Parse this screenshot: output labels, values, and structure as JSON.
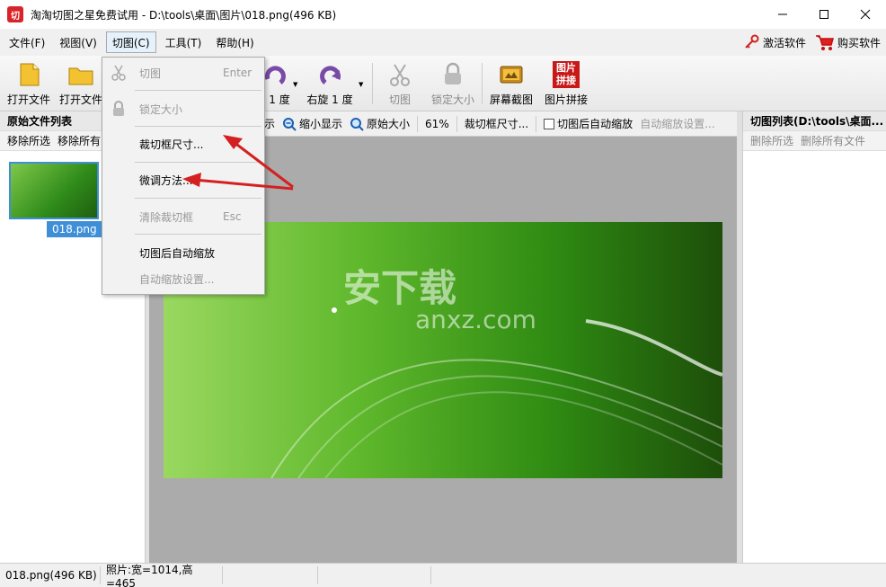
{
  "window": {
    "title": "淘淘切图之星免费试用 - D:\\tools\\桌面\\图片\\018.png(496 KB)",
    "app_icon_text": "切"
  },
  "menubar": {
    "items": [
      "文件(F)",
      "视图(V)",
      "切图(C)",
      "工具(T)",
      "帮助(H)"
    ],
    "activate": "激活软件",
    "buy": "购买软件"
  },
  "toolbar": {
    "open_file": "打开文件",
    "open_folder": "打开文件",
    "rotate_left": "1 度",
    "rotate_right": "右旋 1 度",
    "cut": "切图",
    "lock_size": "锁定大小",
    "screen_capture": "屏幕截图",
    "image_join": "图片拼接",
    "image_join_icon_text": "图片拼接"
  },
  "left_panel": {
    "title": "原始文件列表",
    "remove_selected": "移除所选",
    "remove_all": "移除所有",
    "thumb_label": "018.png"
  },
  "center_toolbar": {
    "show": "示",
    "zoom_out": "缩小显示",
    "original_size": "原始大小",
    "zoom": "61%",
    "crop_size": "裁切框尺寸...",
    "auto_zoom_after_cut": "切图后自动缩放",
    "auto_zoom_settings": "自动缩放设置..."
  },
  "canvas": {
    "watermark": "安下载",
    "watermark_sub": "anxz.com"
  },
  "right_panel": {
    "title": "切图列表(D:\\tools\\桌面...",
    "remove_selected": "删除所选",
    "remove_all": "删除所有文件"
  },
  "statusbar": {
    "file": "018.png(496 KB)",
    "dims": "照片:宽=1014,高=465"
  },
  "dropdown": {
    "cut": "切图",
    "cut_shortcut": "Enter",
    "lock_size": "锁定大小",
    "crop_frame_size": "裁切框尺寸...",
    "fine_tune": "微调方法...",
    "clear_crop": "清除裁切框",
    "clear_shortcut": "Esc",
    "auto_zoom": "切图后自动缩放",
    "auto_zoom_settings": "自动缩放设置..."
  },
  "colors": {
    "accent": "#3e8fd8",
    "arrow": "#d42020",
    "canvas_bg": "#ababab"
  }
}
